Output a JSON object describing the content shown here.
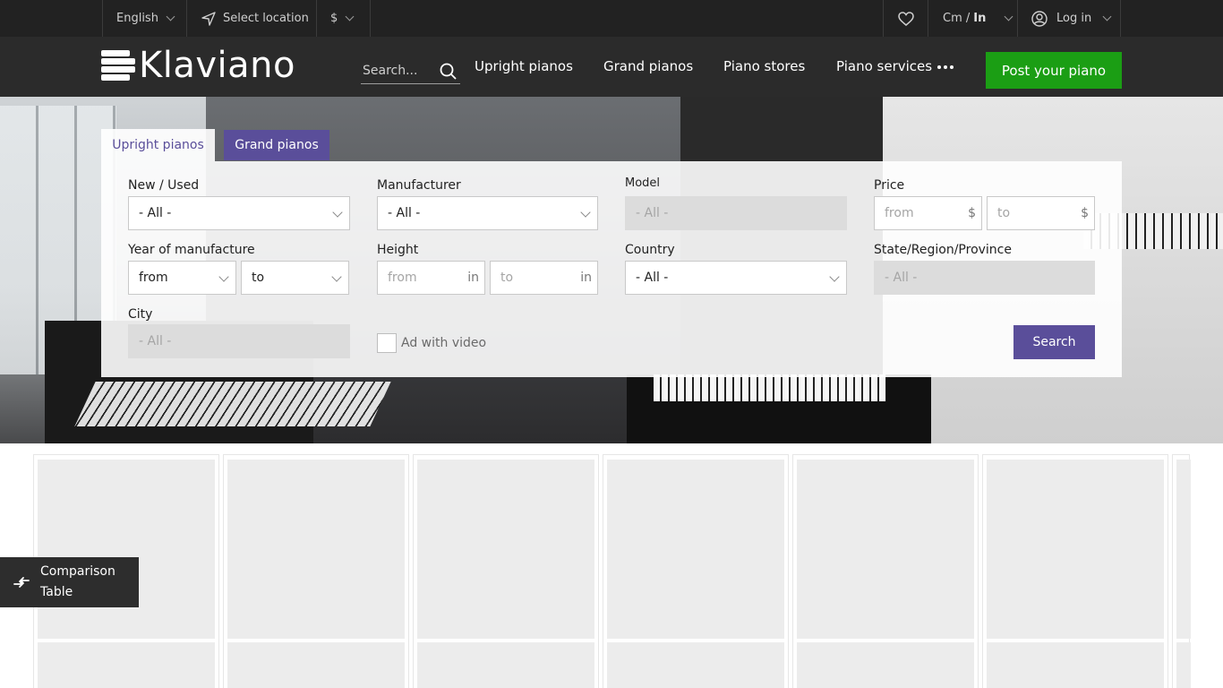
{
  "topbar": {
    "language": "English",
    "location": "Select location",
    "currency": "$",
    "units": {
      "cm": "Cm /",
      "in": "In"
    },
    "login": "Log in"
  },
  "header": {
    "logo_text": "Klaviano",
    "search_placeholder": "Search...",
    "nav": [
      "Upright pianos",
      "Grand pianos",
      "Piano stores",
      "Piano services"
    ],
    "post_button": "Post your piano"
  },
  "filter": {
    "tabs": [
      "Upright pianos",
      "Grand pianos"
    ],
    "new_used": {
      "label": "New / Used",
      "value": "- All -"
    },
    "manufacturer": {
      "label": "Manufacturer",
      "value": "- All -"
    },
    "model": {
      "label": "Model",
      "value": "- All -"
    },
    "price": {
      "label": "Price",
      "from": "from",
      "to": "to",
      "unit": "$"
    },
    "year": {
      "label": "Year of manufacture",
      "from": "from",
      "to": "to"
    },
    "height": {
      "label": "Height",
      "from": "from",
      "to": "to",
      "unit": "in"
    },
    "country": {
      "label": "Country",
      "value": "- All -"
    },
    "state": {
      "label": "State/Region/Province",
      "value": "- All -"
    },
    "city": {
      "label": "City",
      "value": "- All -"
    },
    "video": {
      "label": "Ad with video",
      "checked": false
    },
    "search_button": "Search"
  },
  "comparison": {
    "label": "Comparison Table"
  },
  "colors": {
    "accent": "#5a4e9a",
    "post": "#1b9e14",
    "topbar": "#222222",
    "header": "#2b2b2b"
  },
  "icons": [
    "chevron-down-icon",
    "location-arrow-icon",
    "heart-icon",
    "user-circle-icon",
    "search-icon",
    "more-dots-icon",
    "compare-icon"
  ]
}
